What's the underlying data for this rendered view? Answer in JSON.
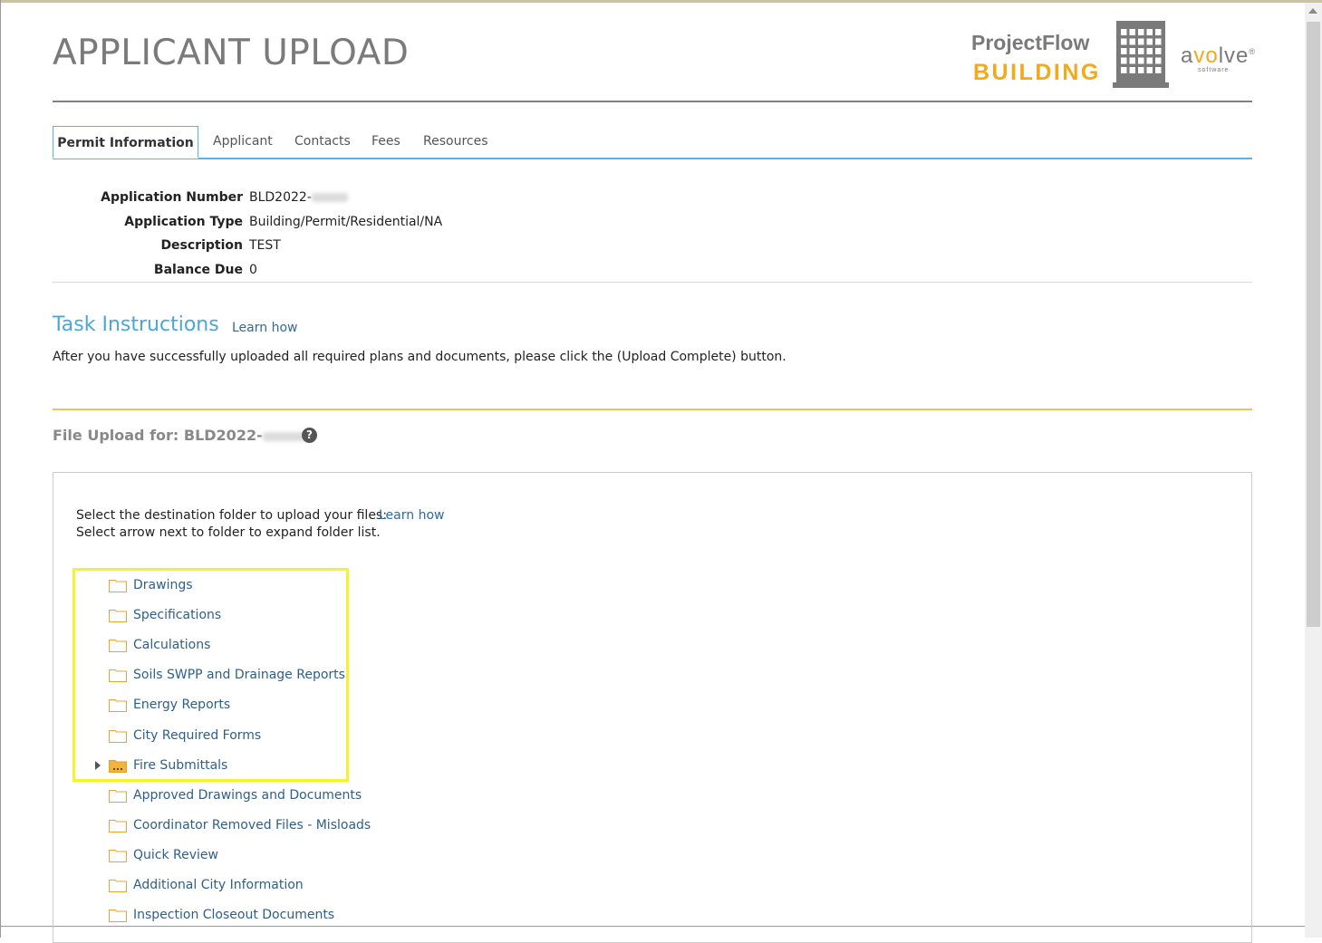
{
  "page": {
    "title": "APPLICANT UPLOAD"
  },
  "logo": {
    "projectflow": "ProjectFlow",
    "building": "BUILDING",
    "avolve_a": "a",
    "avolve_o": "vo",
    "avolve_rest": "lve",
    "avolve_mark": "®",
    "avolve_sub": "software"
  },
  "tabs": [
    {
      "label": "Permit Information",
      "active": true
    },
    {
      "label": "Applicant"
    },
    {
      "label": "Contacts"
    },
    {
      "label": "Fees"
    },
    {
      "label": "Resources"
    }
  ],
  "permit": {
    "application_number_label": "Application Number",
    "application_number_value": "BLD2022-",
    "application_type_label": "Application Type",
    "application_type_value": "Building/Permit/Residential/NA",
    "description_label": "Description",
    "description_value": "TEST",
    "balance_due_label": "Balance Due",
    "balance_due_value": "0"
  },
  "task": {
    "title": "Task Instructions",
    "learn_how": "Learn how",
    "instructions": "After you have successfully uploaded all required plans and documents, please click the (Upload Complete) button."
  },
  "upload": {
    "title_prefix": "File Upload for: BLD2022-",
    "help_icon": "?",
    "select_line1": "Select the destination folder to upload your files:",
    "select_line2": "Select arrow next to folder to expand folder list.",
    "learn_how": "Learn how",
    "folders": [
      {
        "label": "Drawings",
        "filled": false,
        "expandable": false
      },
      {
        "label": "Specifications",
        "filled": false,
        "expandable": false
      },
      {
        "label": "Calculations",
        "filled": false,
        "expandable": false
      },
      {
        "label": "Soils SWPP and Drainage Reports",
        "filled": false,
        "expandable": false
      },
      {
        "label": "Energy Reports",
        "filled": false,
        "expandable": false
      },
      {
        "label": "City Required Forms",
        "filled": false,
        "expandable": false
      },
      {
        "label": "Fire Submittals",
        "filled": true,
        "expandable": true
      },
      {
        "label": "Approved Drawings and Documents",
        "filled": false,
        "expandable": false
      },
      {
        "label": "Coordinator Removed Files - Misloads",
        "filled": false,
        "expandable": false
      },
      {
        "label": "Quick Review",
        "filled": false,
        "expandable": false
      },
      {
        "label": "Additional City Information",
        "filled": false,
        "expandable": false
      },
      {
        "label": "Inspection Closeout Documents",
        "filled": false,
        "expandable": false
      }
    ]
  },
  "colors": {
    "accent_blue": "#5bb4dd",
    "link_blue": "#2d6b9a",
    "brand_orange": "#f2a91d",
    "highlight_yellow": "#f7f32a"
  }
}
